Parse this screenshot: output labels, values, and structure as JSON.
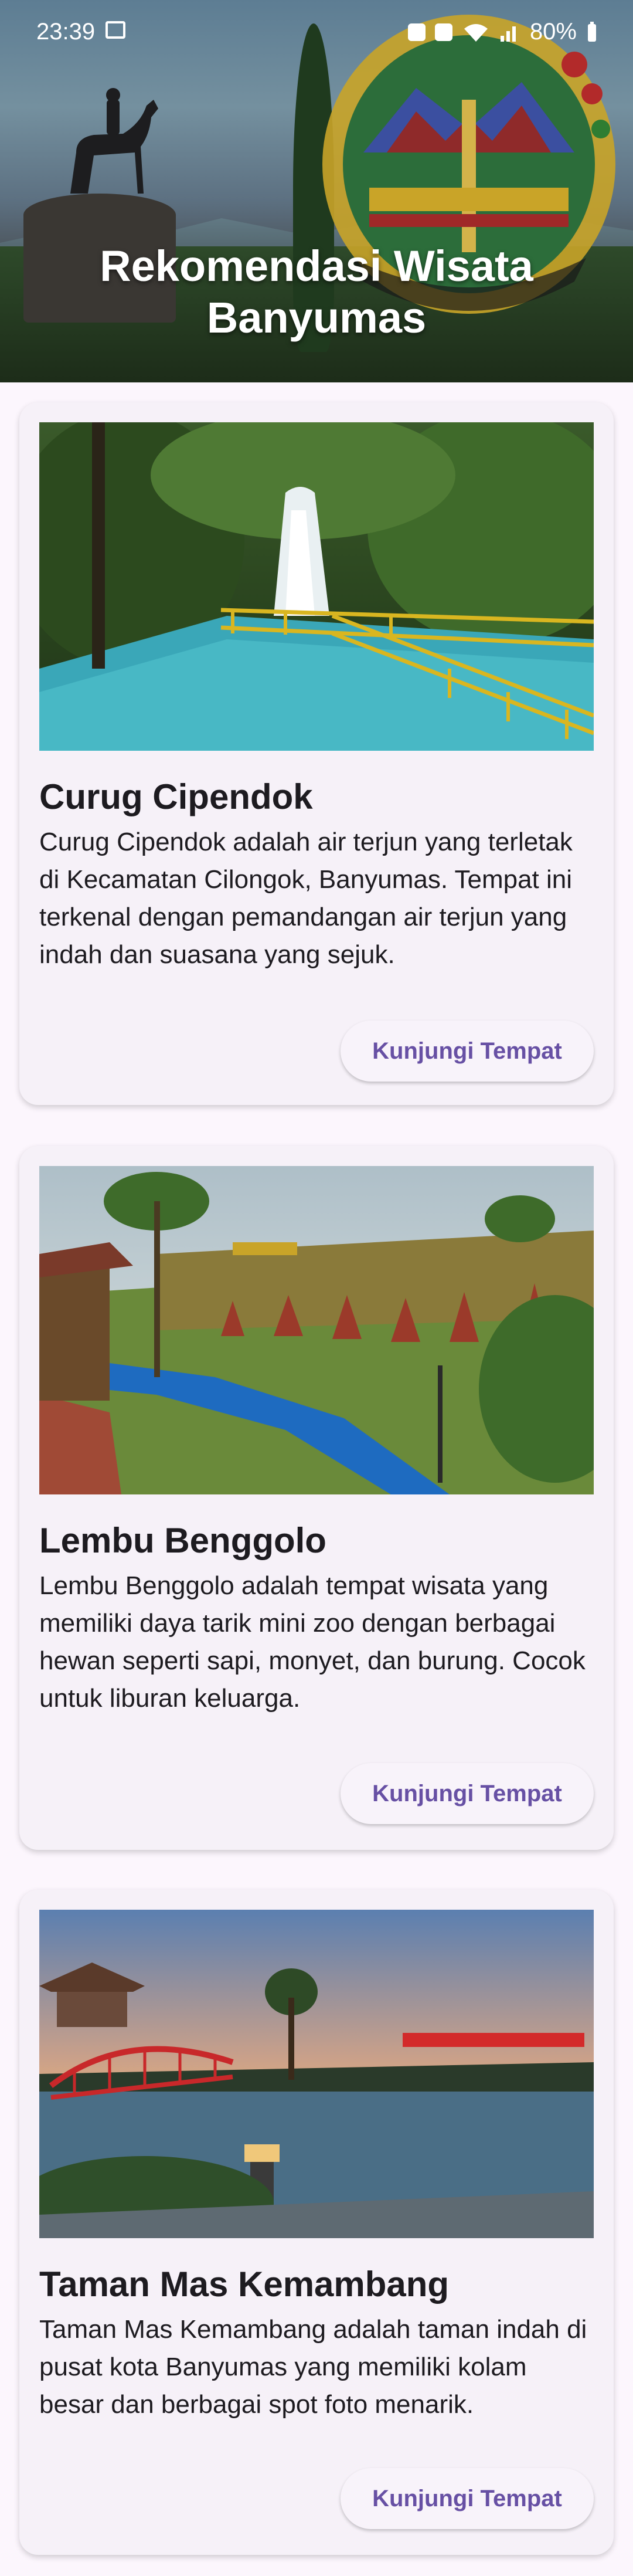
{
  "status_bar": {
    "time": "23:39",
    "battery": "80%"
  },
  "header": {
    "title_line1": "Rekomendasi Wisata",
    "title_line2": "Banyumas"
  },
  "places": [
    {
      "name": "Curug Cipendok",
      "description": "Curug Cipendok adalah air terjun yang terletak di Kecamatan Cilongok, Banyumas. Tempat ini terkenal dengan pemandangan air terjun yang indah dan suasana yang sejuk.",
      "button": "Kunjungi Tempat"
    },
    {
      "name": "Lembu Benggolo",
      "description": "Lembu Benggolo adalah tempat wisata yang memiliki daya tarik mini zoo dengan berbagai hewan seperti sapi, monyet, dan burung. Cocok untuk liburan keluarga.",
      "button": "Kunjungi Tempat"
    },
    {
      "name": "Taman Mas Kemambang",
      "description": "Taman Mas Kemambang adalah taman indah di pusat kota Banyumas yang memiliki kolam besar dan berbagai spot foto menarik.",
      "button": "Kunjungi Tempat"
    }
  ],
  "colors": {
    "accent": "#6750a4",
    "card": "#f6f1f8",
    "background": "#fcf6fd"
  }
}
